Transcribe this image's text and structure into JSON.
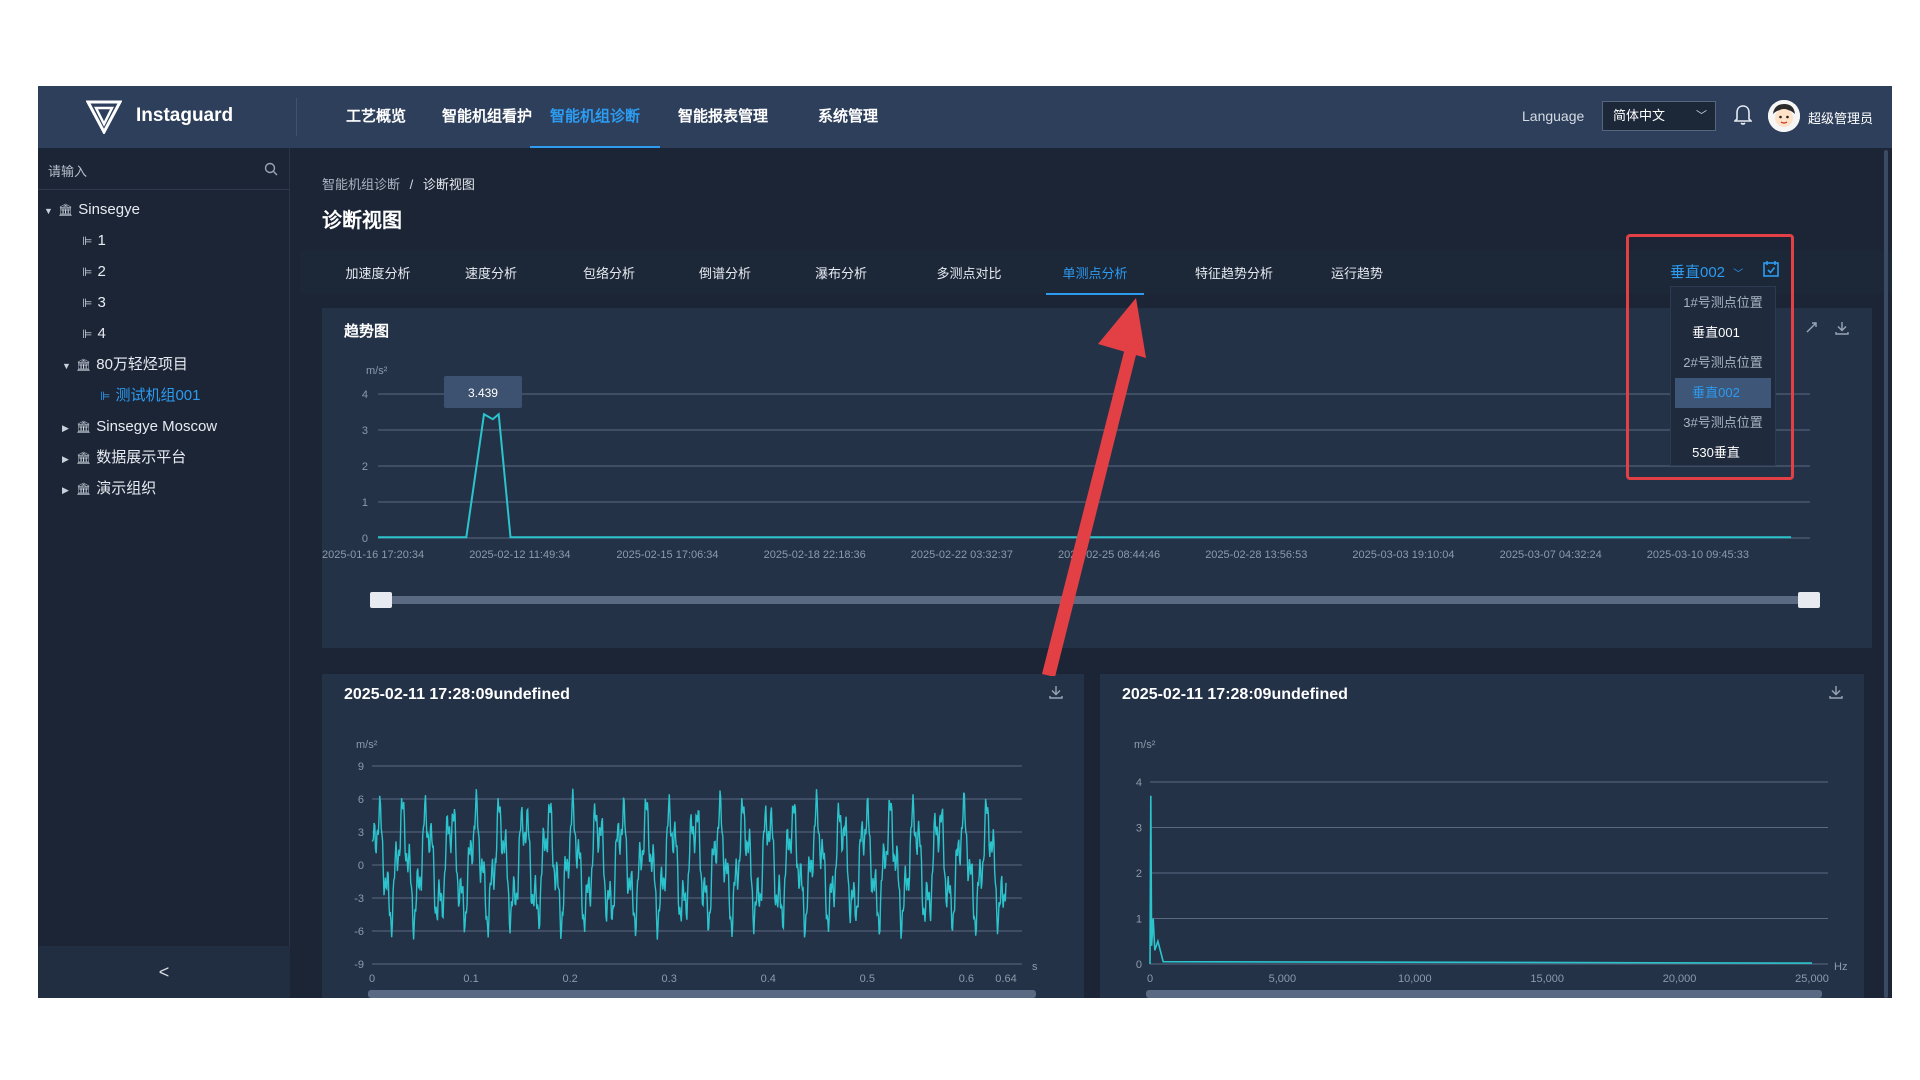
{
  "header": {
    "brand": "Instaguard",
    "nav": [
      {
        "label": "工艺概览",
        "active": false
      },
      {
        "label": "智能机组看护",
        "active": false
      },
      {
        "label": "智能机组诊断",
        "active": true
      },
      {
        "label": "智能报表管理",
        "active": false
      },
      {
        "label": "系统管理",
        "active": false
      }
    ],
    "language_label": "Language",
    "language_value": "简体中文",
    "username": "超级管理员",
    "colors": {
      "header_bg": "#2d3f5b",
      "accent": "#2d9bf0"
    }
  },
  "sidebar": {
    "search_placeholder": "请输入",
    "tree": [
      {
        "label": "Sinsegye",
        "level": 0,
        "expanded": true,
        "icon": "org-icon"
      },
      {
        "label": "1",
        "level": 1,
        "icon": "unit-icon"
      },
      {
        "label": "2",
        "level": 1,
        "icon": "unit-icon"
      },
      {
        "label": "3",
        "level": 1,
        "icon": "unit-icon"
      },
      {
        "label": "4",
        "level": 1,
        "icon": "unit-icon"
      },
      {
        "label": "80万轻烃项目",
        "level": 1,
        "expanded": true,
        "icon": "org-icon"
      },
      {
        "label": "测试机组001",
        "level": 2,
        "selected": true,
        "icon": "unit-icon"
      },
      {
        "label": "Sinsegye Moscow",
        "level": 1,
        "expanded": false,
        "icon": "org-icon"
      },
      {
        "label": "数据展示平台",
        "level": 1,
        "expanded": false,
        "icon": "org-icon"
      },
      {
        "label": "演示组织",
        "level": 1,
        "expanded": false,
        "icon": "org-icon"
      }
    ],
    "collapse_label": "<"
  },
  "main": {
    "breadcrumb": [
      "智能机组诊断",
      "诊断视图"
    ],
    "breadcrumb_sep": "/",
    "title": "诊断视图",
    "tabs": [
      {
        "label": "加速度分析",
        "active": false
      },
      {
        "label": "速度分析",
        "active": false
      },
      {
        "label": "包络分析",
        "active": false
      },
      {
        "label": "倒谱分析",
        "active": false
      },
      {
        "label": "瀑布分析",
        "active": false
      },
      {
        "label": "多测点对比",
        "active": false
      },
      {
        "label": "单测点分析",
        "active": true
      },
      {
        "label": "特征趋势分析",
        "active": false
      },
      {
        "label": "运行趋势",
        "active": false
      }
    ],
    "point_select": "垂直002",
    "dropdown": [
      {
        "label": "1#号测点位置",
        "kind": "group"
      },
      {
        "label": "垂直001",
        "kind": "option",
        "selected": false
      },
      {
        "label": "2#号测点位置",
        "kind": "group"
      },
      {
        "label": "垂直002",
        "kind": "option",
        "selected": true
      },
      {
        "label": "3#号测点位置",
        "kind": "group"
      },
      {
        "label": "530垂直",
        "kind": "option",
        "selected": false
      }
    ]
  },
  "panels": {
    "trend_title": "趋势图",
    "wave_title": "2025-02-11 17:28:09undefined",
    "spectrum_title": "2025-02-11 17:28:09undefined"
  },
  "chart_data": [
    {
      "type": "line",
      "name": "trend",
      "ylabel": "m/s²",
      "ylim": [
        0,
        4
      ],
      "yticks": [
        0,
        1,
        2,
        3,
        4
      ],
      "x_labels": [
        "2025-01-16 17:20:34",
        "2025-02-12 11:49:34",
        "2025-02-15 17:06:34",
        "2025-02-18 22:18:36",
        "2025-02-22 03:32:37",
        "2025-02-25 08:44:46",
        "2025-02-28 13:56:53",
        "2025-03-03 19:10:04",
        "2025-03-07 04:32:24",
        "2025-03-10 09:45:33"
      ],
      "tooltip": "3.439",
      "points": [
        [
          0,
          0.02
        ],
        [
          0.6,
          0.02
        ],
        [
          0.72,
          3.439
        ],
        [
          0.78,
          3.3
        ],
        [
          0.82,
          3.439
        ],
        [
          0.9,
          0.02
        ],
        [
          9.6,
          0.02
        ]
      ],
      "grid": true,
      "color": "#2bc4cc"
    },
    {
      "type": "line",
      "name": "waveform",
      "ylabel": "m/s²",
      "xlabel": "s",
      "ylim": [
        -9,
        9
      ],
      "yticks": [
        -9,
        -6,
        -3,
        0,
        3,
        6,
        9
      ],
      "xlim": [
        0,
        0.64
      ],
      "xticks": [
        "0",
        "0.1",
        "0.2",
        "0.3",
        "0.4",
        "0.5",
        "0.6",
        "0.64"
      ],
      "amplitude": 6.5,
      "cycles": 26,
      "grid": true,
      "color": "#2bc4cc"
    },
    {
      "type": "line",
      "name": "spectrum",
      "ylabel": "m/s²",
      "xlabel": "Hz",
      "ylim": [
        0,
        4
      ],
      "yticks": [
        0,
        1,
        2,
        3,
        4
      ],
      "xlim": [
        0,
        25000
      ],
      "xticks": [
        "0",
        "5,000",
        "10,000",
        "15,000",
        "20,000",
        "25,000"
      ],
      "points": [
        [
          0,
          0
        ],
        [
          30,
          3.7
        ],
        [
          60,
          0.4
        ],
        [
          120,
          1.0
        ],
        [
          180,
          0.3
        ],
        [
          300,
          0.5
        ],
        [
          500,
          0.05
        ],
        [
          25000,
          0.02
        ]
      ],
      "grid": true,
      "color": "#2bc4cc"
    }
  ]
}
